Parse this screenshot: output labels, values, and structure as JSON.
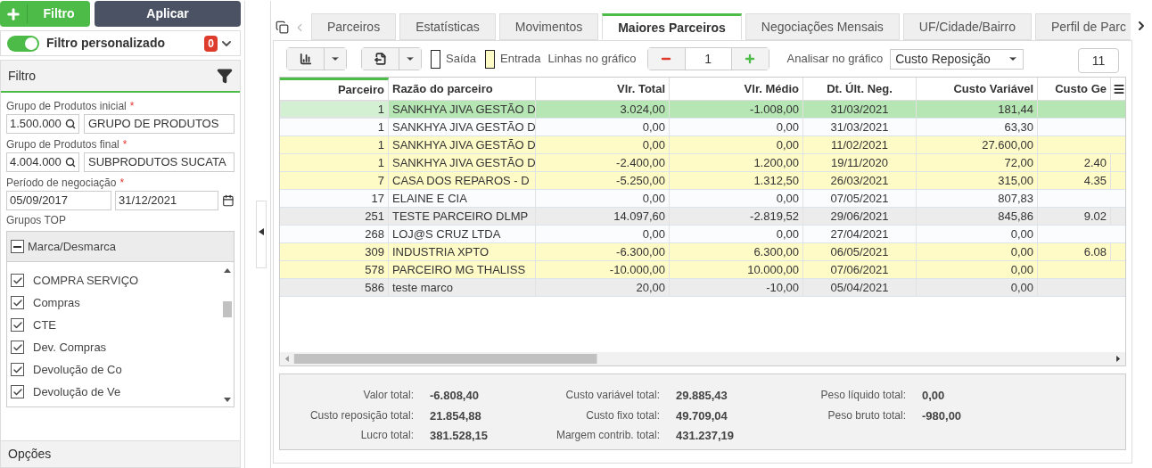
{
  "left_panel": {
    "add_filter_button": "Filtro",
    "apply_button": "Aplicar",
    "custom_filter": {
      "label": "Filtro personalizado",
      "on": true,
      "count": "0"
    },
    "filter_section": {
      "title": "Filtro",
      "fields": [
        {
          "label": "Grupo de Produtos inicial",
          "required_mark": "*",
          "code": "1.500.000",
          "description": "GRUPO DE PRODUTOS"
        },
        {
          "label": "Grupo de Produtos final",
          "required_mark": "*",
          "code": "4.004.000",
          "description": "SUBPRODUTOS SUCATA"
        }
      ],
      "period": {
        "label": "Período de negociação",
        "required_mark": "*",
        "start": "05/09/2017",
        "end": "31/12/2021"
      },
      "groups": {
        "label": "Grupos TOP",
        "toggle_all": "Marca/Desmarca",
        "items": [
          {
            "label": "COMPRA SERVIÇO",
            "checked": true
          },
          {
            "label": "Compras",
            "checked": true
          },
          {
            "label": "CTE",
            "checked": true
          },
          {
            "label": "Dev. Compras",
            "checked": true
          },
          {
            "label": "Devolução de Co",
            "checked": true
          },
          {
            "label": "Devolução de Ve",
            "checked": true
          }
        ]
      }
    },
    "options_section": "Opções"
  },
  "tabs": [
    {
      "label": "Parceiros",
      "selected": false
    },
    {
      "label": "Estatísticas",
      "selected": false
    },
    {
      "label": "Movimentos",
      "selected": false
    },
    {
      "label": "Maiores Parceiros",
      "selected": true
    },
    {
      "label": "Negociações Mensais",
      "selected": false
    },
    {
      "label": "UF/Cidade/Bairro",
      "selected": false
    },
    {
      "label": "Perfil de Parc",
      "selected": false
    }
  ],
  "toolbar": {
    "legend": [
      {
        "label": "Saída",
        "color": "#ffffff"
      },
      {
        "label": "Entrada",
        "color": "#fffbc7"
      }
    ],
    "lines_label": "Linhas no gráfico",
    "lines_value": "1",
    "analyze_label": "Analisar no gráfico",
    "analyze_value": "Custo Reposição",
    "count": "11"
  },
  "table": {
    "columns": [
      "Parceiro",
      "Razão do parceiro",
      "Vlr. Total",
      "Vlr. Médio",
      "Dt. Últ. Neg.",
      "Custo Variável",
      "Custo Ge"
    ],
    "rows": [
      {
        "kind": "saida",
        "selected": true,
        "cells": [
          "1",
          "SANKHYA JIVA GESTÃO D",
          "3.024,00",
          "-1.008,00",
          "31/03/2021",
          "181,44"
        ]
      },
      {
        "kind": "saida",
        "selected": false,
        "cells": [
          "1",
          "SANKHYA JIVA GESTÃO D",
          "0,00",
          "0,00",
          "31/03/2021",
          "63,30"
        ]
      },
      {
        "kind": "entrada",
        "selected": false,
        "cells": [
          "1",
          "SANKHYA JIVA GESTÃO D",
          "0,00",
          "0,00",
          "11/02/2021",
          "27.600,00"
        ]
      },
      {
        "kind": "entrada",
        "selected": false,
        "cells": [
          "1",
          "SANKHYA JIVA GESTÃO D",
          "-2.400,00",
          "1.200,00",
          "19/11/2020",
          "72,00",
          "2.40"
        ]
      },
      {
        "kind": "entrada",
        "selected": false,
        "cells": [
          "7",
          "CASA DOS REPAROS - D",
          "-5.250,00",
          "1.312,50",
          "26/03/2021",
          "315,00",
          "4.35"
        ]
      },
      {
        "kind": "saida",
        "selected": false,
        "cells": [
          "17",
          "ELAINE E CIA",
          "0,00",
          "0,00",
          "07/05/2021",
          "807,83"
        ]
      },
      {
        "kind": "other",
        "selected": false,
        "cells": [
          "251",
          "TESTE PARCEIRO DLMP",
          "14.097,60",
          "-2.819,52",
          "29/06/2021",
          "845,86",
          "9.02"
        ]
      },
      {
        "kind": "saida",
        "selected": false,
        "cells": [
          "268",
          "LOJ@S CRUZ LTDA",
          "0,00",
          "0,00",
          "27/04/2021",
          "0,00"
        ]
      },
      {
        "kind": "entrada",
        "selected": false,
        "cells": [
          "309",
          "INDUSTRIA XPTO",
          "-6.300,00",
          "6.300,00",
          "06/05/2021",
          "0,00",
          "6.08"
        ]
      },
      {
        "kind": "entrada",
        "selected": false,
        "cells": [
          "578",
          "PARCEIRO MG THALISS",
          "-10.000,00",
          "10.000,00",
          "07/06/2021",
          "0,00"
        ]
      },
      {
        "kind": "other",
        "selected": false,
        "cells": [
          "586",
          "teste marco",
          "20,00",
          "-10,00",
          "05/04/2021",
          "0,00"
        ]
      }
    ]
  },
  "totals": [
    [
      {
        "label": "Valor total:",
        "value": "-6.808,40"
      },
      {
        "label": "Custo reposição total:",
        "value": "21.854,88"
      },
      {
        "label": "Lucro total:",
        "value": "381.528,15"
      }
    ],
    [
      {
        "label": "Custo variável total:",
        "value": "29.885,43"
      },
      {
        "label": "Custo fixo total:",
        "value": "49.709,04"
      },
      {
        "label": "Margem contrib. total:",
        "value": "431.237,19"
      }
    ],
    [
      {
        "label": "Peso líquido total:",
        "value": "0,00"
      },
      {
        "label": "Peso bruto total:",
        "value": "-980,00"
      }
    ]
  ]
}
